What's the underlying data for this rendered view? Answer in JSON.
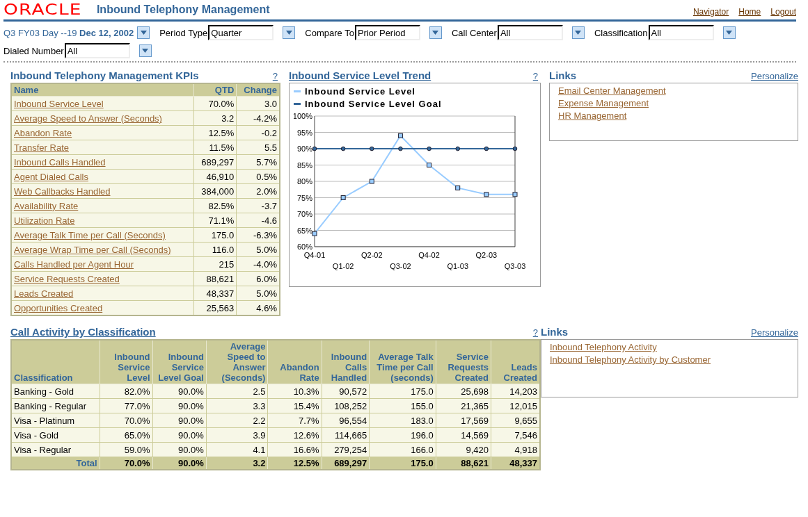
{
  "header": {
    "logo": "ORACLE",
    "title": "Inbound Telephony Management",
    "links": [
      "Navigator",
      "Home",
      "Logout"
    ]
  },
  "period": {
    "text": "Q3 FY03 Day --19 **Dec 12, 2002**"
  },
  "filters": [
    {
      "label": "Period Type",
      "value": "Quarter"
    },
    {
      "label": "Compare To",
      "value": "Prior Period"
    },
    {
      "label": "Call Center",
      "value": "All"
    },
    {
      "label": "Classification",
      "value": "All"
    },
    {
      "label": "Dialed Number",
      "value": "All"
    }
  ],
  "kpis": {
    "title": "Inbound Telephony Management KPIs",
    "help": "?",
    "columns": [
      "Name",
      "QTD",
      "Change"
    ],
    "rows": [
      {
        "name": "Inbound Service Level",
        "qtd": "70.0%",
        "change": "3.0"
      },
      {
        "name": "Average Speed to Answer (Seconds)",
        "qtd": "3.2",
        "change": "-4.2%"
      },
      {
        "name": "Abandon Rate",
        "qtd": "12.5%",
        "change": "-0.2"
      },
      {
        "name": "Transfer Rate",
        "qtd": "11.5%",
        "change": "5.5"
      },
      {
        "name": "Inbound Calls Handled",
        "qtd": "689,297",
        "change": "5.7%"
      },
      {
        "name": "Agent Dialed Calls",
        "qtd": "46,910",
        "change": "0.5%"
      },
      {
        "name": "Web Callbacks Handled",
        "qtd": "384,000",
        "change": "2.0%"
      },
      {
        "name": "Availability Rate",
        "qtd": "82.5%",
        "change": "-3.7"
      },
      {
        "name": "Utilization Rate",
        "qtd": "71.1%",
        "change": "-4.6"
      },
      {
        "name": "Average Talk Time per Call (Seconds)",
        "qtd": "175.0",
        "change": "-6.3%"
      },
      {
        "name": "Average Wrap Time per Call (Seconds)",
        "qtd": "116.0",
        "change": "5.0%"
      },
      {
        "name": "Calls Handled per Agent Hour",
        "qtd": "215",
        "change": "-4.0%"
      },
      {
        "name": "Service Requests Created",
        "qtd": "88,621",
        "change": "6.0%"
      },
      {
        "name": "Leads Created",
        "qtd": "48,337",
        "change": "5.0%"
      },
      {
        "name": "Opportunities Created",
        "qtd": "25,563",
        "change": "4.6%"
      }
    ]
  },
  "trend": {
    "title": "Inbound Service Level Trend",
    "help": "?",
    "chart_data": {
      "type": "line",
      "categories": [
        "Q4-01",
        "Q1-02",
        "Q2-02",
        "Q3-02",
        "Q4-02",
        "Q1-03",
        "Q2-03",
        "Q3-03"
      ],
      "series": [
        {
          "name": "Inbound Service Level",
          "color": "#99ccff",
          "marker": "square",
          "values": [
            64,
            75,
            80,
            94,
            85,
            78,
            76,
            76
          ]
        },
        {
          "name": "Inbound Service Level Goal",
          "color": "#336699",
          "marker": "circle",
          "values": [
            90,
            90,
            90,
            90,
            90,
            90,
            90,
            90
          ]
        }
      ],
      "grid": true,
      "ylim": [
        60,
        100
      ],
      "yticks": [
        {
          "value": 60,
          "label": "60%"
        },
        {
          "value": 65,
          "label": "65%"
        },
        {
          "value": 70,
          "label": "70%"
        },
        {
          "value": 75,
          "label": "75%"
        },
        {
          "value": 80,
          "label": "80%"
        },
        {
          "value": 85,
          "label": "85%"
        },
        {
          "value": 90,
          "label": "90%"
        },
        {
          "value": 95,
          "label": "95%"
        },
        {
          "value": 100,
          "label": "100%"
        }
      ]
    }
  },
  "links_top": {
    "title": "Links",
    "action": "Personalize",
    "items": [
      "Email Center Management",
      "Expense Management",
      "HR Management"
    ]
  },
  "activity": {
    "title": "Call Activity by Classification",
    "help": "?",
    "columns": [
      "Classification",
      "Inbound Service Level",
      "Inbound Service Level Goal",
      "Average Speed to Answer (Seconds)",
      "Abandon Rate",
      "Inbound Calls Handled",
      "Average Talk Time per Call (seconds)",
      "Service Requests Created",
      "Leads Created"
    ],
    "rows": [
      {
        "cells": [
          "Banking - Gold",
          "82.0%",
          "90.0%",
          "2.5",
          "10.3%",
          "90,572",
          "175.0",
          "25,698",
          "14,203"
        ]
      },
      {
        "cells": [
          "Banking - Regular",
          "77.0%",
          "90.0%",
          "3.3",
          "15.4%",
          "108,252",
          "155.0",
          "21,365",
          "12,015"
        ]
      },
      {
        "cells": [
          "Visa - Platinum",
          "70.0%",
          "90.0%",
          "2.2",
          "7.7%",
          "96,554",
          "183.0",
          "17,569",
          "9,655"
        ]
      },
      {
        "cells": [
          "Visa - Gold",
          "65.0%",
          "90.0%",
          "3.9",
          "12.6%",
          "114,665",
          "196.0",
          "14,569",
          "7,546"
        ]
      },
      {
        "cells": [
          "Visa - Regular",
          "59.0%",
          "90.0%",
          "4.1",
          "16.6%",
          "279,254",
          "166.0",
          "9,420",
          "4,918"
        ]
      }
    ],
    "total": [
      "Total",
      "70.0%",
      "90.0%",
      "3.2",
      "12.5%",
      "689,297",
      "175.0",
      "88,621",
      "48,337"
    ]
  },
  "links_bottom": {
    "title": "Links",
    "action": "Personalize",
    "items": [
      "Inbound Telephony Activity",
      "Inbound Telephony Activity by Customer"
    ]
  }
}
